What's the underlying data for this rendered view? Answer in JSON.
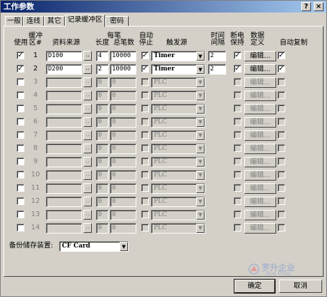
{
  "window": {
    "title": "工作参数",
    "help_glyph": "?",
    "close_glyph": "×"
  },
  "tabs": [
    {
      "label": "一般",
      "active": false
    },
    {
      "label": "连线",
      "active": false
    },
    {
      "label": "其它",
      "active": false
    },
    {
      "label": "记录缓冲区",
      "active": true
    },
    {
      "label": "密码",
      "active": false
    }
  ],
  "headers": {
    "use": "使用",
    "buffer_no": [
      "缓冲",
      "区#"
    ],
    "source": "资料来源",
    "per_record": "每笔",
    "length": "长度",
    "total": "总笔数",
    "auto_stop": [
      "自动",
      "停止"
    ],
    "trigger": "触发源",
    "interval": [
      "时间",
      "间隔"
    ],
    "retain": [
      "断电",
      "保持"
    ],
    "data_def": [
      "数据",
      "定义"
    ],
    "auto_copy": "自动复制"
  },
  "icons": {
    "check": "✓",
    "browse": "..",
    "dropdown": "▼"
  },
  "rows": [
    {
      "use": true,
      "num": "1",
      "source": "D100",
      "length": "4",
      "total": "10000",
      "auto_stop": true,
      "trigger": "Timer",
      "interval": "2",
      "retain": true,
      "edit": "编辑...",
      "auto_copy": true,
      "enabled": true
    },
    {
      "use": true,
      "num": "2",
      "source": "D200",
      "length": "2",
      "total": "10000",
      "auto_stop": true,
      "trigger": "Timer",
      "interval": "2",
      "retain": true,
      "edit": "编辑...",
      "auto_copy": true,
      "enabled": true
    },
    {
      "use": false,
      "num": "3",
      "source": "",
      "length": "0",
      "total": "0",
      "auto_stop": false,
      "trigger": "PLC",
      "interval": "",
      "retain": false,
      "edit": "编辑...",
      "auto_copy": false,
      "enabled": false
    },
    {
      "use": false,
      "num": "4",
      "source": "",
      "length": "0",
      "total": "0",
      "auto_stop": false,
      "trigger": "PLC",
      "interval": "",
      "retain": false,
      "edit": "编辑...",
      "auto_copy": false,
      "enabled": false
    },
    {
      "use": false,
      "num": "5",
      "source": "",
      "length": "0",
      "total": "0",
      "auto_stop": false,
      "trigger": "PLC",
      "interval": "",
      "retain": false,
      "edit": "编辑...",
      "auto_copy": false,
      "enabled": false
    },
    {
      "use": false,
      "num": "6",
      "source": "",
      "length": "0",
      "total": "0",
      "auto_stop": false,
      "trigger": "PLC",
      "interval": "",
      "retain": false,
      "edit": "编辑...",
      "auto_copy": false,
      "enabled": false
    },
    {
      "use": false,
      "num": "7",
      "source": "",
      "length": "0",
      "total": "0",
      "auto_stop": false,
      "trigger": "PLC",
      "interval": "",
      "retain": false,
      "edit": "编辑...",
      "auto_copy": false,
      "enabled": false
    },
    {
      "use": false,
      "num": "8",
      "source": "",
      "length": "0",
      "total": "0",
      "auto_stop": false,
      "trigger": "PLC",
      "interval": "",
      "retain": false,
      "edit": "编辑...",
      "auto_copy": false,
      "enabled": false
    },
    {
      "use": false,
      "num": "9",
      "source": "",
      "length": "0",
      "total": "0",
      "auto_stop": false,
      "trigger": "PLC",
      "interval": "",
      "retain": false,
      "edit": "编辑...",
      "auto_copy": false,
      "enabled": false
    },
    {
      "use": false,
      "num": "10",
      "source": "",
      "length": "0",
      "total": "0",
      "auto_stop": false,
      "trigger": "PLC",
      "interval": "",
      "retain": false,
      "edit": "编辑...",
      "auto_copy": false,
      "enabled": false
    },
    {
      "use": false,
      "num": "11",
      "source": "",
      "length": "0",
      "total": "0",
      "auto_stop": false,
      "trigger": "PLC",
      "interval": "",
      "retain": false,
      "edit": "编辑...",
      "auto_copy": false,
      "enabled": false
    },
    {
      "use": false,
      "num": "12",
      "source": "",
      "length": "0",
      "total": "0",
      "auto_stop": false,
      "trigger": "PLC",
      "interval": "",
      "retain": false,
      "edit": "编辑...",
      "auto_copy": false,
      "enabled": false
    },
    {
      "use": false,
      "num": "13",
      "source": "",
      "length": "0",
      "total": "0",
      "auto_stop": false,
      "trigger": "PLC",
      "interval": "",
      "retain": false,
      "edit": "编辑...",
      "auto_copy": false,
      "enabled": false
    },
    {
      "use": false,
      "num": "14",
      "source": "",
      "length": "0",
      "total": "0",
      "auto_stop": false,
      "trigger": "PLC",
      "interval": "",
      "retain": false,
      "edit": "编辑...",
      "auto_copy": false,
      "enabled": false
    }
  ],
  "backup": {
    "label": "备份储存装置:",
    "value": "CF Card"
  },
  "buttons": {
    "ok": "确定",
    "cancel": "取消"
  },
  "watermark": {
    "cn": "罗升企业",
    "en": "Ace Pillar"
  }
}
